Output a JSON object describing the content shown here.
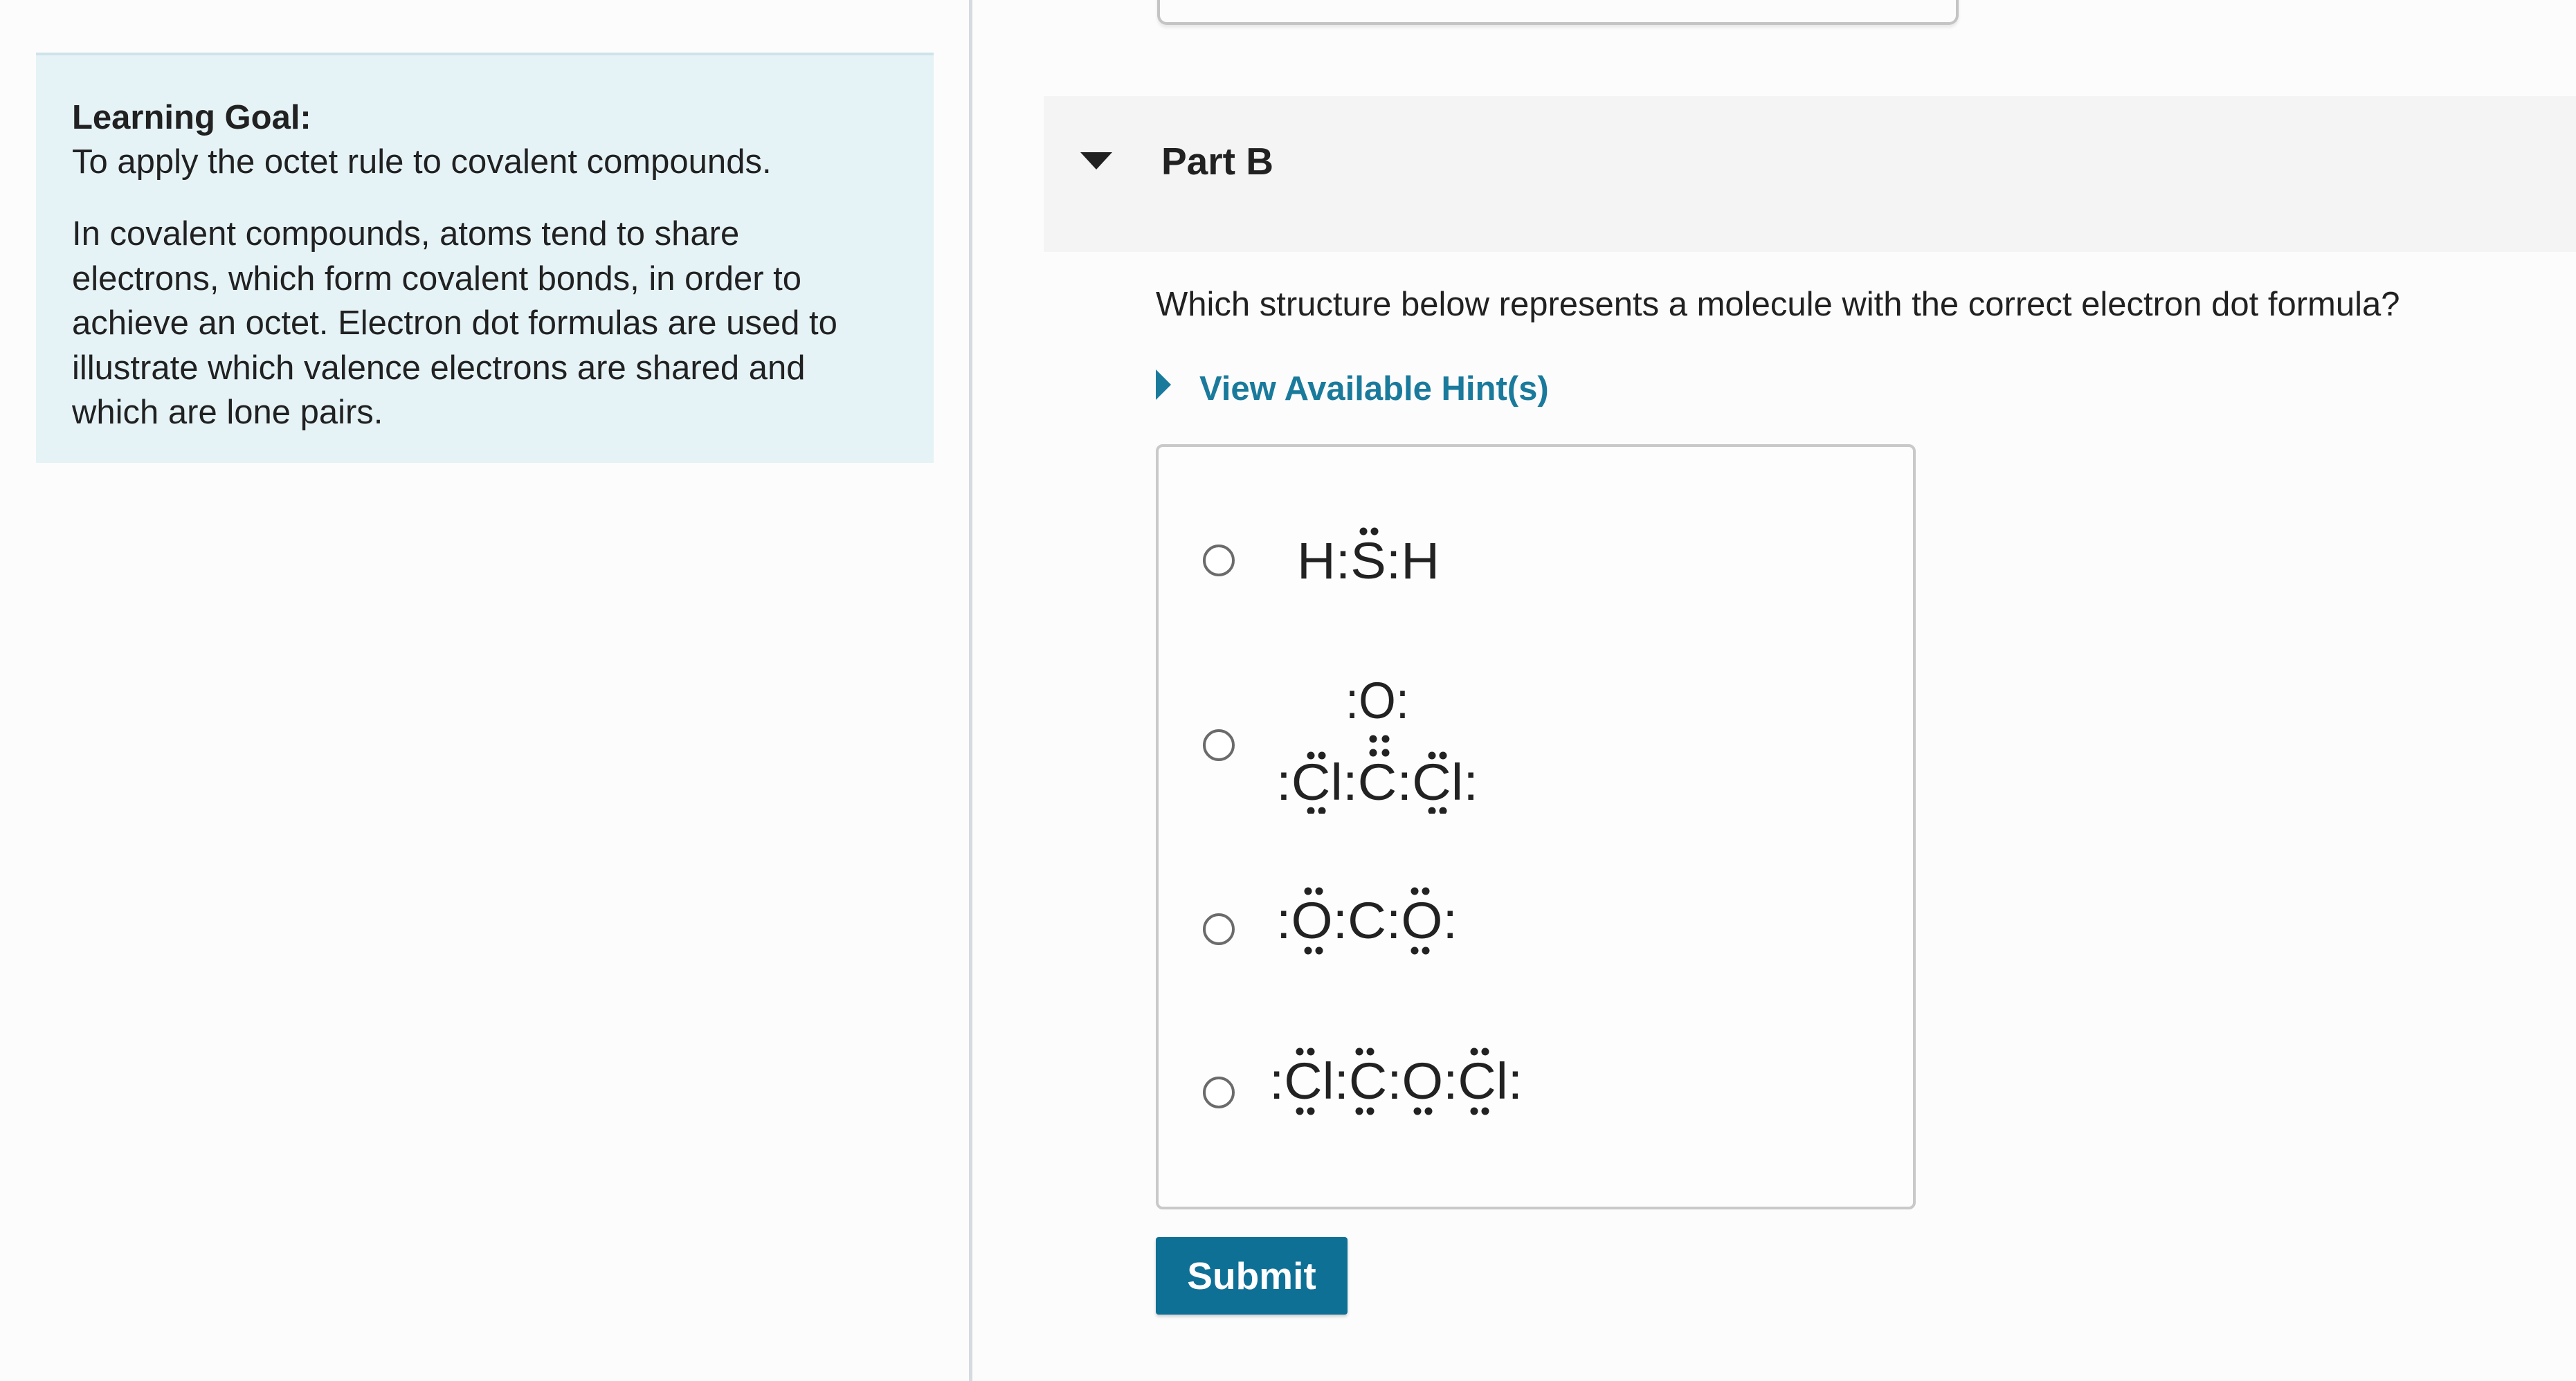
{
  "learning_goal": {
    "title": "Learning Goal:",
    "line": "To apply the octet rule to covalent compounds.",
    "paragraph_lines": [
      "In covalent compounds, atoms tend to share",
      "electrons, which form covalent bonds, in order to",
      "achieve an octet. Electron dot formulas are used to",
      "illustrate which valence electrons are shared and",
      "which are lone pairs."
    ]
  },
  "part": {
    "title": "Part B",
    "question": "Which structure below represents a molecule with the correct electron dot formula?",
    "hint_label": "View Available Hint(s)",
    "choices": [
      {
        "formula": "H:S:H"
      },
      {
        "formula_top": ":O:",
        "formula": ":Cl:C:Cl:"
      },
      {
        "formula": ":O:C:O:"
      },
      {
        "formula": ":Cl:C:O:Cl:"
      }
    ],
    "submit_label": "Submit"
  },
  "colors": {
    "accent": "#0f7096",
    "link": "#1a7a9c",
    "goal_background": "#e5f3f7"
  },
  "icons": {
    "part_toggle": "caret-down-icon",
    "hint_toggle": "caret-right-icon"
  }
}
